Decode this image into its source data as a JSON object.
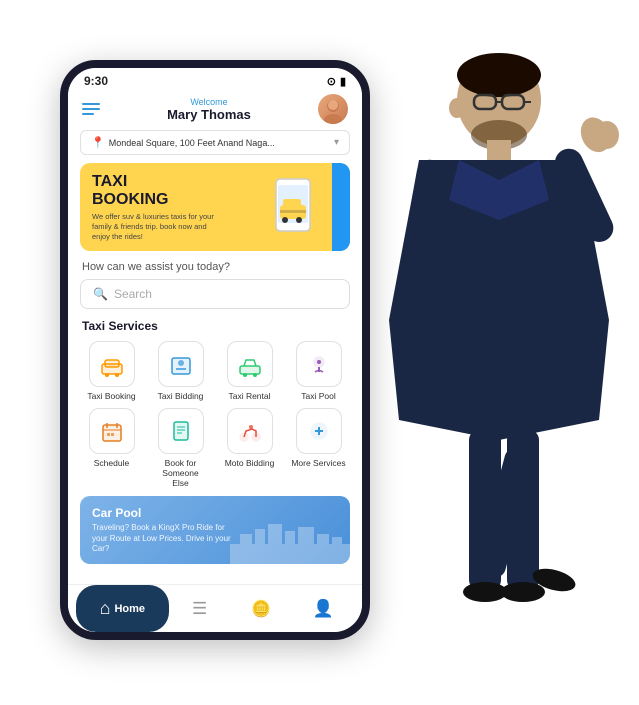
{
  "status_bar": {
    "time": "9:30",
    "arrow": "↗"
  },
  "header": {
    "welcome": "Welcome",
    "user_name": "Mary Thomas",
    "hamburger_label": "menu"
  },
  "location": {
    "text": "Mondeal Square, 100 Feet Anand Naga...",
    "chevron": "▾"
  },
  "banner": {
    "title_line1": "TAXI",
    "title_line2": "BOOKING",
    "description": "We offer suv & luxuries taxis for your family & friends trip. book now and enjoy the rides!"
  },
  "search": {
    "prompt": "How can we assist you today?",
    "placeholder": "Search"
  },
  "taxi_services": {
    "title": "Taxi Services",
    "items": [
      {
        "label": "Taxi Booking",
        "icon": "🚖",
        "color": "#ff6b6b"
      },
      {
        "label": "Taxi Bidding",
        "icon": "📋",
        "color": "#3498db"
      },
      {
        "label": "Taxi Rental",
        "icon": "🚗",
        "color": "#2ecc71"
      },
      {
        "label": "Taxi Pool",
        "icon": "📍",
        "color": "#9b59b6"
      },
      {
        "label": "Schedule",
        "icon": "📅",
        "color": "#e67e22"
      },
      {
        "label": "Book for Someone Else",
        "icon": "📄",
        "color": "#1abc9c"
      },
      {
        "label": "Moto Bidding",
        "icon": "🏍️",
        "color": "#e74c3c"
      },
      {
        "label": "More Services",
        "icon": "➕",
        "color": "#3498db"
      }
    ]
  },
  "carpool": {
    "title": "Car Pool",
    "description": "Traveling? Book a KingX Pro Ride for your Route at Low Prices. Drive in your Car?"
  },
  "bottom_nav": {
    "items": [
      {
        "label": "Home",
        "icon": "⌂",
        "active": true
      },
      {
        "label": "Bookings",
        "icon": "☰",
        "active": false
      },
      {
        "label": "Wallet",
        "icon": "🪙",
        "active": false
      },
      {
        "label": "Profile",
        "icon": "👤",
        "active": false
      }
    ]
  }
}
